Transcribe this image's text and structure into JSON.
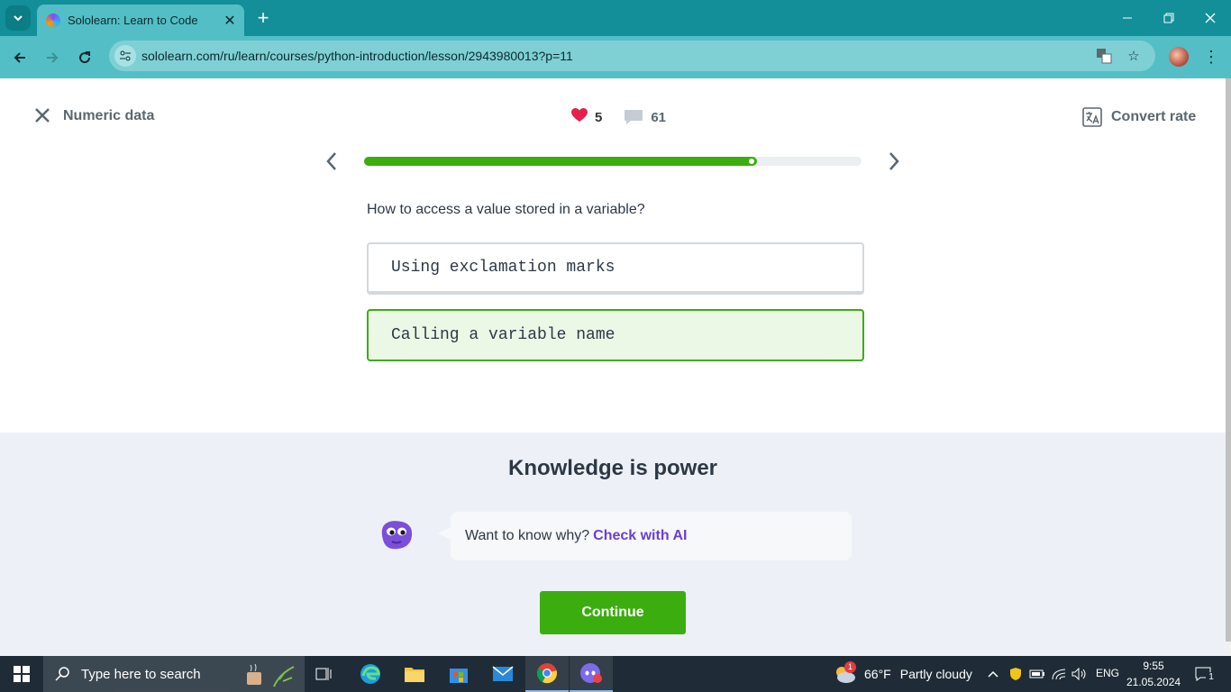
{
  "browser": {
    "tab_title": "Sololearn: Learn to Code",
    "url": "sololearn.com/ru/learn/courses/python-introduction/lesson/2943980013?p=11"
  },
  "lesson": {
    "title": "Numeric data",
    "likes": "5",
    "comments": "61",
    "convert_label": "Convert rate",
    "progress": 0.79
  },
  "quiz": {
    "question": "How to access a value stored in a variable?",
    "options": [
      {
        "label": "Using exclamation marks",
        "state": "unselected"
      },
      {
        "label": "Calling a variable name",
        "state": "correct"
      }
    ]
  },
  "feedback": {
    "title": "Knowledge is power",
    "prompt": "Want to know why?",
    "link": "Check with AI",
    "continue_label": "Continue"
  },
  "taskbar": {
    "search_placeholder": "Type here to search",
    "weather_temp": "66°F",
    "weather_desc": "Partly cloudy",
    "weather_badge": "1",
    "language": "ENG",
    "time": "9:55",
    "date": "21.05.2024",
    "notifications": "1"
  },
  "colors": {
    "brand_teal": "#128f98",
    "toolbar": "#53bec5",
    "success_green": "#3bad0f",
    "heart": "#e61e4d",
    "ai_purple": "#6a3fd6"
  }
}
